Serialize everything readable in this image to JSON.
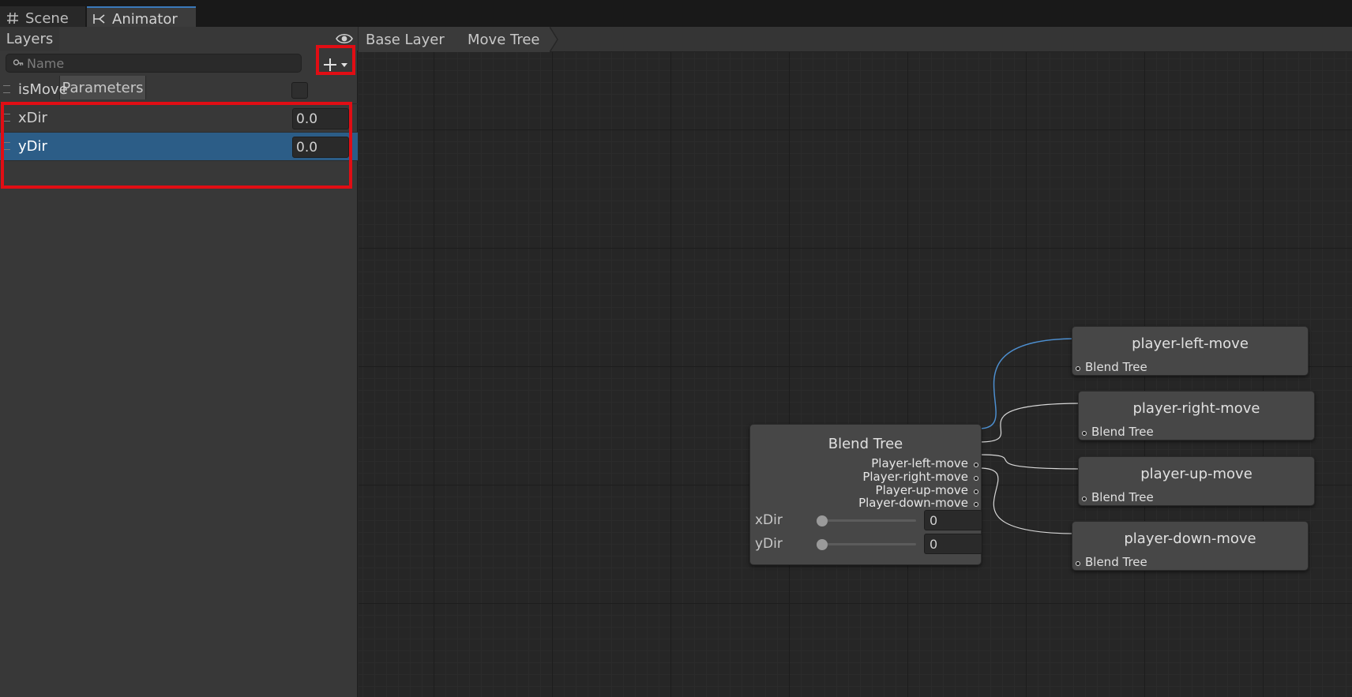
{
  "tabs": [
    {
      "label": "Scene",
      "icon": "grid-icon"
    },
    {
      "label": "Animator",
      "icon": "animator-icon"
    }
  ],
  "left_panel": {
    "subtabs": [
      "Layers",
      "Parameters"
    ],
    "search_placeholder": "Name",
    "parameters": [
      {
        "name": "isMove",
        "type": "bool",
        "value": false
      },
      {
        "name": "xDir",
        "type": "float",
        "value": "0.0"
      },
      {
        "name": "yDir",
        "type": "float",
        "value": "0.0",
        "selected": true
      }
    ]
  },
  "breadcrumb": [
    "Base Layer",
    "Move Tree"
  ],
  "blend_tree": {
    "title": "Blend Tree",
    "outputs": [
      "Player-left-move",
      "Player-right-move",
      "Player-up-move",
      "Player-down-move"
    ],
    "sliders": [
      {
        "label": "xDir",
        "value": "0"
      },
      {
        "label": "yDir",
        "value": "0"
      }
    ]
  },
  "motion_nodes": [
    {
      "title": "player-left-move",
      "sub": "Blend Tree"
    },
    {
      "title": "player-right-move",
      "sub": "Blend Tree"
    },
    {
      "title": "player-up-move",
      "sub": "Blend Tree"
    },
    {
      "title": "player-down-move",
      "sub": "Blend Tree"
    }
  ],
  "colors": {
    "highlight_box": "#e10d14",
    "selected_row": "#2c5d87",
    "active_wire": "#4d8fd0",
    "tab_accent": "#3a79bb"
  }
}
